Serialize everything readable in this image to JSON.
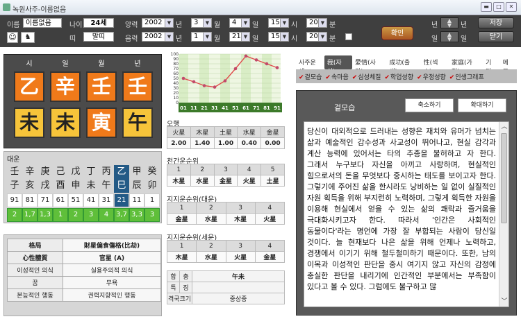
{
  "window": {
    "title": "녹원사주-이름없음"
  },
  "top": {
    "name_label": "이름",
    "name_value": "이름없음",
    "age_label": "나이",
    "age_value": "24세",
    "tti_label": "띠",
    "tti_value": "말띠",
    "solar_label": "양력",
    "lunar_label": "음력",
    "solar": {
      "year": "2002",
      "month": "3",
      "day": "4",
      "hour": "15",
      "minute": "20"
    },
    "lunar": {
      "year": "2002",
      "month": "1",
      "day": "21",
      "hour": "15",
      "minute": "20"
    },
    "unit_year": "년",
    "unit_month": "월",
    "unit_day": "일",
    "unit_hour": "시",
    "unit_minute": "분",
    "confirm": "확인",
    "right_year_label": "년",
    "right_day_label": "일",
    "save": "저장",
    "close": "닫기"
  },
  "pillars": {
    "headers": [
      "시",
      "일",
      "월",
      "년"
    ],
    "stems": [
      "乙",
      "辛",
      "壬",
      "壬"
    ],
    "branches": [
      "未",
      "未",
      "寅",
      "午"
    ],
    "stem_colors": [
      "orange",
      "orange",
      "orange",
      "orange"
    ],
    "branch_colors": [
      "yellow",
      "yellow",
      "orange",
      "yellow"
    ]
  },
  "daeun": {
    "label": "대운",
    "stems": [
      "壬",
      "辛",
      "庚",
      "己",
      "戊",
      "丁",
      "丙",
      "乙",
      "甲",
      "癸"
    ],
    "branches": [
      "子",
      "亥",
      "戌",
      "酉",
      "申",
      "未",
      "午",
      "巳",
      "辰",
      "卯"
    ],
    "ages": [
      "91",
      "81",
      "71",
      "61",
      "51",
      "41",
      "31",
      "21",
      "11",
      "1"
    ],
    "nums": [
      "2",
      "1,7",
      "1,3",
      "1",
      "2",
      "3",
      "4",
      "3,7",
      "3,3",
      "3"
    ],
    "highlight_index": 7
  },
  "info": [
    {
      "k": "格局",
      "v": "財星偏食傷格(比劫)"
    },
    {
      "k": "心性體質",
      "v": "官星 (A)"
    },
    {
      "k": "이성적인 의식",
      "v": "실용주의적 의식"
    },
    {
      "k": "꿈",
      "v": "무욕"
    },
    {
      "k": "본능적인 행동",
      "v": "권력지향적인 행동"
    }
  ],
  "chart_data": {
    "type": "line",
    "x": [
      1,
      11,
      21,
      31,
      41,
      51,
      61,
      71,
      81,
      91
    ],
    "x_labels": [
      "01",
      "11",
      "21",
      "31",
      "41",
      "51",
      "61",
      "71",
      "81",
      "91"
    ],
    "y": [
      50,
      43,
      35,
      32,
      45,
      70,
      96,
      88,
      80,
      72
    ],
    "ylim": [
      0,
      100
    ],
    "y_ticks": [
      "100",
      "90",
      "80",
      "70",
      "60",
      "50",
      "40",
      "30",
      "20",
      "10",
      "0"
    ],
    "line_color": "#e04a4a",
    "marker_color": "#c24a6a"
  },
  "ohaeng": {
    "title": "오행",
    "heads": [
      "火星",
      "木星",
      "土星",
      "水星",
      "金星"
    ],
    "vals": [
      "2.00",
      "1.40",
      "1.00",
      "0.40",
      "0.00"
    ]
  },
  "cheongan": {
    "title": "천간운순위",
    "heads": [
      "1",
      "2",
      "3",
      "4",
      "5"
    ],
    "vals": [
      "木星",
      "水星",
      "金星",
      "火星",
      "土星"
    ]
  },
  "jiji_daeun": {
    "title": "지지운순위(대운)",
    "heads": [
      "1",
      "2",
      "3",
      "4"
    ],
    "vals": [
      "金星",
      "水星",
      "木星",
      "火星"
    ]
  },
  "jiji_seun": {
    "title": "지지운순위(세운)",
    "heads": [
      "1",
      "2",
      "3",
      "4"
    ],
    "vals": [
      "木星",
      "水星",
      "火星",
      "金星"
    ]
  },
  "hapchung": {
    "r1k": "합",
    "r1k2": "충",
    "r1v": "午未",
    "r2k": "특",
    "r2k2": "징",
    "r2v": "",
    "r3k": "격국크기",
    "r3v": "중상중"
  },
  "tabs": [
    "사주운세",
    "我(자신)",
    "愛情(사랑)",
    "成功(출세)",
    "性(섹스)",
    "家庭(가정)",
    "기타",
    "메모"
  ],
  "subtabs": [
    "겉모습",
    "속마음",
    "심성체질",
    "학업성향",
    "우정성향",
    "인생그래프"
  ],
  "detail": {
    "title": "겉모습",
    "shrink": "축소하기",
    "expand": "확대하기",
    "body": "당신이 대외적으로 드러내는 성향은 재치와 유머가 넘치는 삶과 예술적인 감수성과 사교성이 뛰어나고, 현실 감각과 계산 능력에 있어서는 타의 추종을 불허하고 자 한다. 그래서 누구보다 자신을 아끼고 사랑하며, 현실적인 힘으로서의 돈을 무엇보다 중시하는 태도를 보이고자 한다. 그렇기에 주어진 삶을 한시라도 낭비하는 일 없이 실질적인 자원 획득을 위해 부지런히 노력하며, 그렇게 획득한 자원을 이용해 현실에서 얻을 수 있는 삶의 쾌락과 즐거움을 극대화시키고자 한다. 따라서 '인간은 사회적인 동물이다'라는 명언에 가장 잘 부합되는 사람이 당신일 것이다. 늘 현재보다 나은 삶을 위해 언제나 노력하고, 경쟁에서 이기기 위해 철두철미하기 때문이다. 또한, 남의 이목과 이성적인 판단을 중시 여기지 않고 자신의 감정에 충실한 판단을 내리기에 인간적인 부분에서는 부족함이 있다고 볼 수 있다. 그럼에도 불구하고 많"
  }
}
